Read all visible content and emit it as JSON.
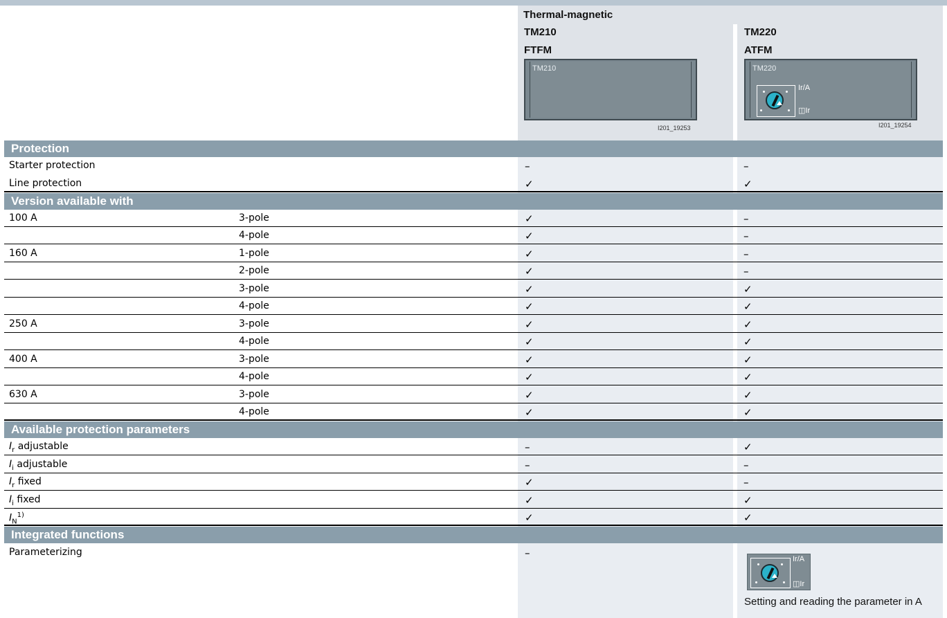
{
  "header": {
    "group_title": "Thermal-magnetic",
    "col1": {
      "model": "TM210",
      "variant": "FTFM",
      "device_label": "TM210",
      "image_id": "I201_19253"
    },
    "col2": {
      "model": "TM220",
      "variant": "ATFM",
      "device_label": "TM220",
      "image_id": "I201_19254",
      "dial_label_top": "Ir/A",
      "dial_label_bottom": "Ir"
    }
  },
  "sections": {
    "protection": "Protection",
    "version": "Version available with",
    "parameters": "Available protection parameters",
    "functions": "Integrated functions"
  },
  "protection_rows": [
    {
      "label": "Starter protection",
      "tm210": "–",
      "tm220": "–"
    },
    {
      "label": "Line protection",
      "tm210": "✓",
      "tm220": "✓"
    }
  ],
  "version_rows": [
    {
      "current": "100 A",
      "pole": "3-pole",
      "tm210": "✓",
      "tm220": "–"
    },
    {
      "current": "",
      "pole": "4-pole",
      "tm210": "✓",
      "tm220": "–"
    },
    {
      "current": "160 A",
      "pole": "1-pole",
      "tm210": "✓",
      "tm220": "–"
    },
    {
      "current": "",
      "pole": "2-pole",
      "tm210": "✓",
      "tm220": "–"
    },
    {
      "current": "",
      "pole": "3-pole",
      "tm210": "✓",
      "tm220": "✓"
    },
    {
      "current": "",
      "pole": "4-pole",
      "tm210": "✓",
      "tm220": "✓"
    },
    {
      "current": "250 A",
      "pole": "3-pole",
      "tm210": "✓",
      "tm220": "✓"
    },
    {
      "current": "",
      "pole": "4-pole",
      "tm210": "✓",
      "tm220": "✓"
    },
    {
      "current": "400 A",
      "pole": "3-pole",
      "tm210": "✓",
      "tm220": "✓"
    },
    {
      "current": "",
      "pole": "4-pole",
      "tm210": "✓",
      "tm220": "✓"
    },
    {
      "current": "630 A",
      "pole": "3-pole",
      "tm210": "✓",
      "tm220": "✓"
    },
    {
      "current": "",
      "pole": "4-pole",
      "tm210": "✓",
      "tm220": "✓"
    }
  ],
  "parameter_rows": [
    {
      "sym": "I",
      "sub": "r",
      "sup": "",
      "text": " adjustable",
      "tm210": "–",
      "tm220": "✓"
    },
    {
      "sym": "I",
      "sub": "i",
      "sup": "",
      "text": " adjustable",
      "tm210": "–",
      "tm220": "–"
    },
    {
      "sym": "I",
      "sub": "r",
      "sup": "",
      "text": " fixed",
      "tm210": "✓",
      "tm220": "–"
    },
    {
      "sym": "I",
      "sub": "i",
      "sup": "",
      "text": " fixed",
      "tm210": "✓",
      "tm220": "✓"
    },
    {
      "sym": "I",
      "sub": "N",
      "sup": "1)",
      "text": "",
      "tm210": "✓",
      "tm220": "✓"
    }
  ],
  "function_rows": [
    {
      "label": "Parameterizing",
      "tm210": "–",
      "tm220_desc": "Setting and reading the parameter in A"
    }
  ]
}
